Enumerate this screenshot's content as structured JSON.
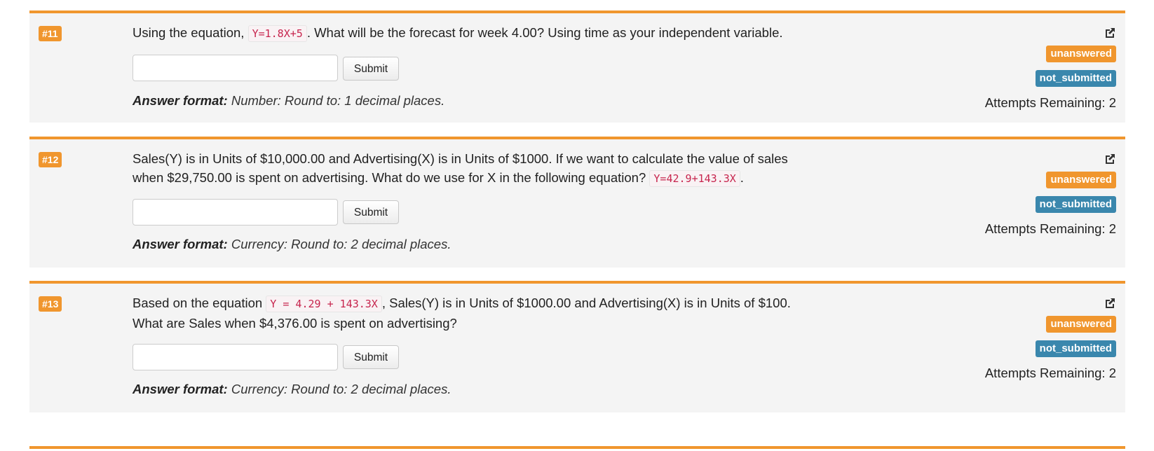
{
  "submit_label": "Submit",
  "answer_format_label": "Answer format:",
  "status_unanswered": "unanswered",
  "status_not_submitted": "not_submitted",
  "colors": {
    "accent": "#f0962e",
    "info": "#3a87ad",
    "code": "#c7254e"
  },
  "questions": [
    {
      "number": "#11",
      "text_before": "Using the equation, ",
      "equation": "Y=1.8X+5",
      "text_after": ". What will be the forecast for week 4.00? Using time as your independent variable.",
      "answer_value": "",
      "format_text": " Number: Round to: 1 decimal places.",
      "attempts": "Attempts Remaining: 2"
    },
    {
      "number": "#12",
      "text_before": "Sales(Y) is in Units of $10,000.00 and Advertising(X) is in Units of $1000. If we want to calculate the value of sales when $29,750.00 is spent on advertising. What do we use for X in the following equation? ",
      "equation": "Y=42.9+143.3X",
      "text_after": ".",
      "answer_value": "",
      "format_text": " Currency: Round to: 2 decimal places.",
      "attempts": "Attempts Remaining: 2"
    },
    {
      "number": "#13",
      "text_before": "Based on the equation ",
      "equation": "Y = 4.29 + 143.3X",
      "text_after": ", Sales(Y) is in Units of $1000.00 and Advertising(X) is in Units of $100. What are Sales when $4,376.00 is spent on advertising?",
      "answer_value": "",
      "format_text": " Currency: Round to: 2 decimal places.",
      "attempts": "Attempts Remaining: 2"
    }
  ]
}
